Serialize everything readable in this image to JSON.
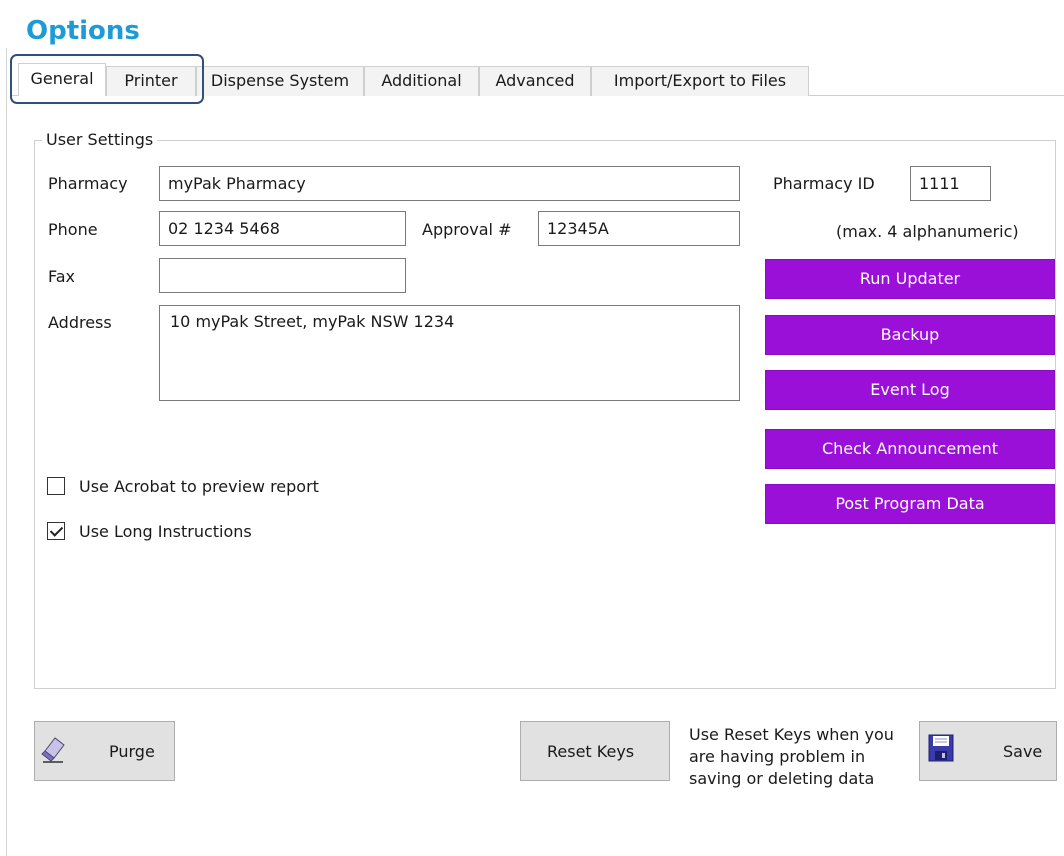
{
  "title": "Options",
  "tabs": [
    "General",
    "Printer",
    "Dispense System",
    "Additional",
    "Advanced",
    "Import/Export to Files"
  ],
  "group_title": "User Settings",
  "form": {
    "pharmacy_label": "Pharmacy",
    "pharmacy_value": "myPak Pharmacy",
    "phone_label": "Phone",
    "phone_value": "02 1234 5468",
    "approval_label": "Approval #",
    "approval_value": "12345A",
    "fax_label": "Fax",
    "fax_value": "",
    "address_label": "Address",
    "address_value": "10 myPak Street, myPak NSW 1234",
    "pharmacy_id_label": "Pharmacy ID",
    "pharmacy_id_value": "1111",
    "pharmacy_id_hint": "(max. 4 alphanumeric)"
  },
  "actions": {
    "run_updater": "Run Updater",
    "backup": "Backup",
    "event_log": "Event Log",
    "check_announcement": "Check Announcement",
    "post_program_data": "Post Program Data"
  },
  "options": {
    "use_acrobat_label": "Use Acrobat to preview report",
    "use_acrobat_checked": false,
    "use_long_instructions_label": "Use Long Instructions",
    "use_long_instructions_checked": true
  },
  "footer": {
    "purge_label": "Purge",
    "reset_keys_label": "Reset Keys",
    "reset_note": "Use Reset Keys when you are having problem in saving or deleting data",
    "save_label": "Save"
  },
  "colors": {
    "title": "#1e9bd7",
    "action_button": "#9b10d9",
    "tab_highlight": "#2f4f7f"
  },
  "icons": {
    "purge": "eraser-icon",
    "save": "floppy-disk-icon",
    "checkbox_checked": "checkmark-icon"
  }
}
